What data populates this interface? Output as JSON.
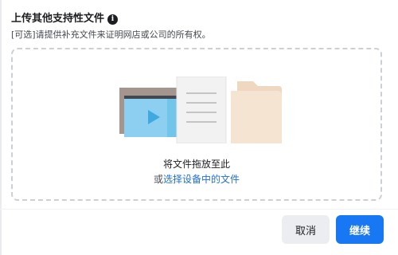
{
  "header": {
    "title": "上传其他支持性文件",
    "info_icon": "info-icon"
  },
  "subtitle": "[可选]请提供补充文件来证明网店或公司的所有权。",
  "dropzone": {
    "drop_text": "将文件拖放至此",
    "or_text": "或",
    "select_link": "选择设备中的文件",
    "illustration_icons": [
      "video-file-icon",
      "document-icon",
      "folder-icon"
    ]
  },
  "footer": {
    "cancel_label": "取消",
    "continue_label": "继续"
  },
  "colors": {
    "primary": "#1877f2",
    "link": "#216fdb",
    "cancel_bg": "#ebedf0",
    "dashed_border": "#ccd0d5"
  }
}
